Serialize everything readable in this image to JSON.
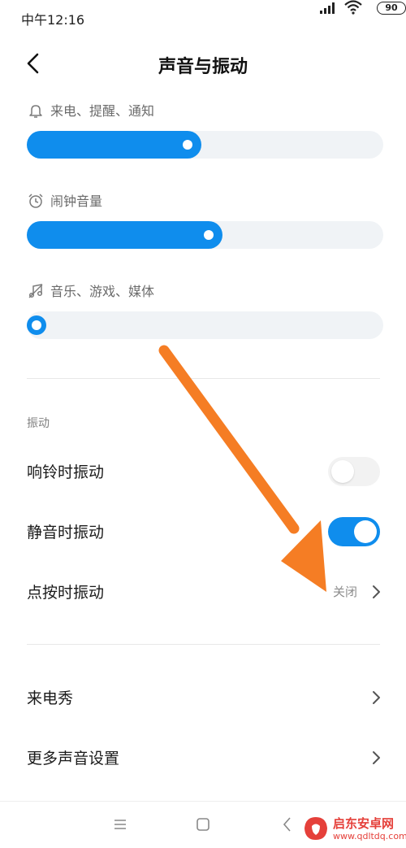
{
  "status_bar": {
    "time": "中午12:16",
    "battery": "90"
  },
  "header": {
    "title": "声音与振动"
  },
  "volume": [
    {
      "label": "来电、提醒、通知",
      "icon": "bell-icon",
      "level_percent": 49
    },
    {
      "label": "闹钟音量",
      "icon": "alarm-clock-icon",
      "level_percent": 55
    },
    {
      "label": "音乐、游戏、媒体",
      "icon": "music-note-icon",
      "level_percent": 0
    }
  ],
  "vibration": {
    "section_title": "振动",
    "ring_vibrate": {
      "label": "响铃时振动",
      "on": false
    },
    "silent_vibrate": {
      "label": "静音时振动",
      "on": true
    },
    "touch_vibrate": {
      "label": "点按时振动",
      "value": "关闭"
    }
  },
  "more": {
    "caller_show": "来电秀",
    "more_sound": "更多声音设置"
  },
  "watermark": {
    "name": "启东安卓网",
    "url": "www.qdltdq.com"
  },
  "colors": {
    "accent": "#0f8ded",
    "arrow": "#f57d24"
  }
}
